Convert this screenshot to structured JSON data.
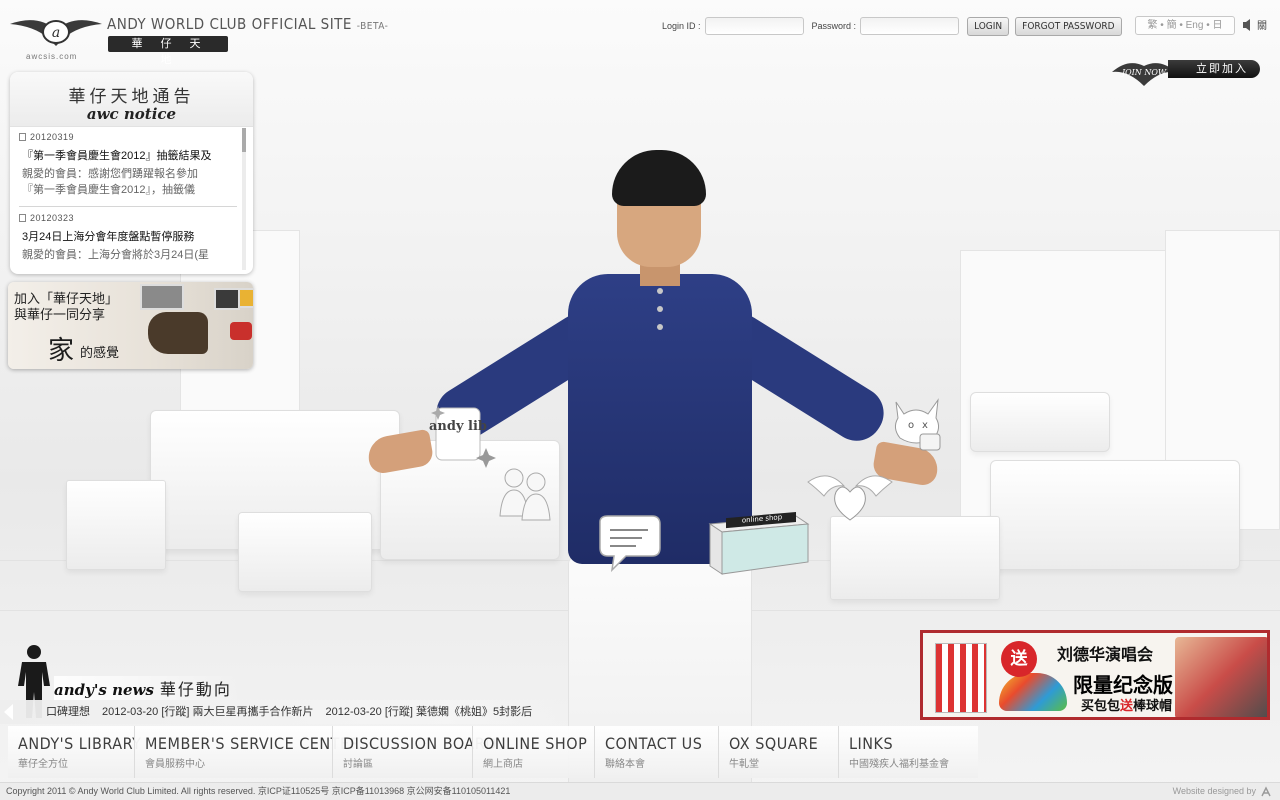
{
  "header": {
    "site_title": "ANDY WORLD CLUB OFFICIAL SITE",
    "beta_tag": "-BETA-",
    "cn_badge": "華仔天地",
    "domain": "awcsis.com",
    "login": {
      "login_id_label": "Login ID :",
      "password_label": "Password :",
      "login_button": "LOGIN",
      "forgot_button": "FORGOT PASSWORD"
    },
    "language_selector": "繁 • 簡 • Eng • 日",
    "sound_toggle_label": "關",
    "join_button": "立即加入",
    "join_emblem_text": "JOIN NOW"
  },
  "notice": {
    "title_cn": "華仔天地通告",
    "title_en": "awc notice",
    "items": [
      {
        "date": "20120319",
        "title": "『第一季會員慶生會2012』抽籤結果及",
        "body_lines": [
          "親愛的會員：感謝您們踴躍報名參加",
          "『第一季會員慶生會2012』，抽籤儀"
        ]
      },
      {
        "date": "20120323",
        "title": "3月24日上海分會年度盤點暫停服務",
        "body_lines": [
          "親愛的會員：上海分會將於3月24日(星"
        ]
      }
    ]
  },
  "join_banner": {
    "line1": "加入「華仔天地」",
    "line2": "與華仔一同分享",
    "line3_big": "家",
    "line3_small": "的感覺"
  },
  "hotspots": {
    "library": "andy lib",
    "shop": "online shop"
  },
  "news": {
    "label_en": "andy's news",
    "label_cn": "華仔動向",
    "ticker_items": [
      "口碑理想",
      "2012-03-20 [行蹤] 兩大巨星再攜手合作新片",
      "2012-03-20 [行蹤] 葉德嫻《桃姐》5封影后"
    ]
  },
  "concert_ad": {
    "badge": "送",
    "title": "刘德华演唱会",
    "subtitle": "限量纪念版",
    "line3_pre": "买包包",
    "line3_highlight": "送",
    "line3_post": "棒球帽"
  },
  "nav": [
    {
      "en": "ANDY'S LIBRARY",
      "cn": "華仔全方位"
    },
    {
      "en": "MEMBER'S SERVICE CENTER",
      "cn": "會員服務中心"
    },
    {
      "en": "DISCUSSION BOARD",
      "cn": "討論區"
    },
    {
      "en": "ONLINE SHOP",
      "cn": "網上商店"
    },
    {
      "en": "CONTACT US",
      "cn": "聯絡本會"
    },
    {
      "en": "OX SQUARE",
      "cn": "牛軋堂"
    },
    {
      "en": "LINKS",
      "cn": "中國殘疾人福利基金會"
    }
  ],
  "footer": {
    "copyright": "Copyright 2011 © Andy World Club Limited. All rights reserved.  京ICP证110525号  京ICP备11013968  京公网安备110105011421",
    "designed_by": "Website designed by"
  },
  "colors": {
    "ad_border": "#b02b2e",
    "ad_badge": "#d8262a",
    "shirt": "#2a3a7e",
    "nav_text": "#3d3d3d"
  }
}
